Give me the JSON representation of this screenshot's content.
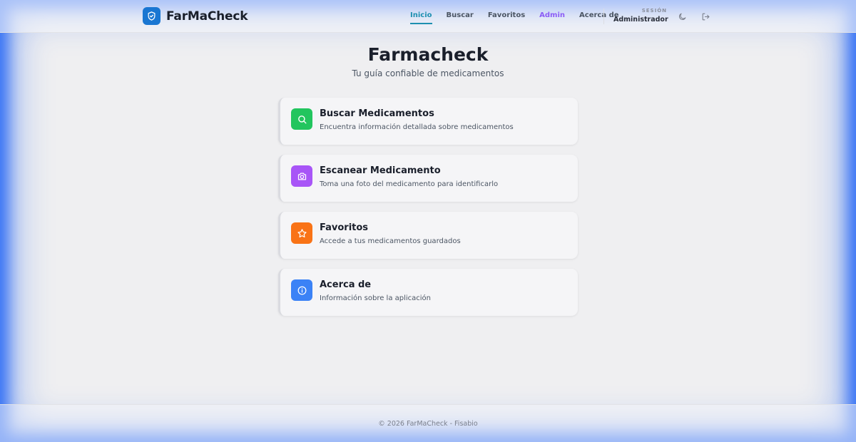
{
  "header": {
    "brand": "FarMaCheck",
    "nav": [
      "Inicio",
      "Buscar",
      "Favoritos",
      "Admin",
      "Acerca de"
    ],
    "active_nav": "Inicio",
    "session_label": "SESIÓN",
    "session_user": "Administrador",
    "icons": {
      "brand": "shield-check-icon",
      "theme": "moon-icon",
      "logout": "logout-icon"
    }
  },
  "main": {
    "title": "Farmacheck",
    "subtitle": "Tu guía confiable de medicamentos",
    "cards": [
      {
        "title": "Buscar Medicamentos",
        "description": "Encuentra información detallada sobre medicamentos",
        "icon": "search-icon",
        "color": "#22c55e"
      },
      {
        "title": "Escanear Medicamento",
        "description": "Toma una foto del medicamento para identificarlo",
        "icon": "camera-icon",
        "color": "#a855f7"
      },
      {
        "title": "Favoritos",
        "description": "Accede a tus medicamentos guardados",
        "icon": "star-icon",
        "color": "#f97316"
      },
      {
        "title": "Acerca de",
        "description": "Información sobre la aplicación",
        "icon": "info-icon",
        "color": "#3b82f6"
      }
    ]
  },
  "footer": {
    "text": "© 2026 FarMaCheck - Fisabio"
  },
  "colors": {
    "accent": "#1d8fb0",
    "brand": "#1976d2",
    "admin": "#8b5cf6"
  }
}
